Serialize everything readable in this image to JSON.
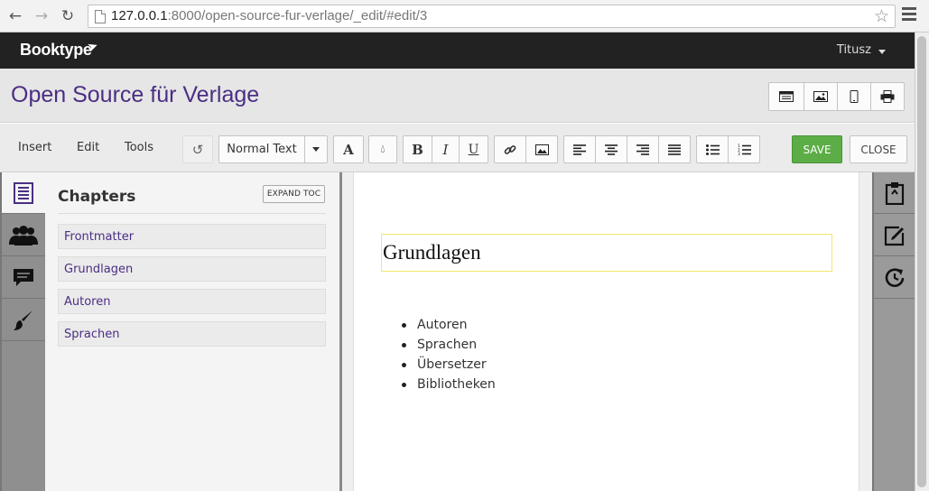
{
  "browser": {
    "url_host": "127.0.0.1",
    "url_rest": ":8000/open-source-fur-verlage/_edit/#edit/3"
  },
  "header": {
    "logo": "Booktype",
    "user": "Titusz"
  },
  "book": {
    "title": "Open Source für Verlage"
  },
  "view_buttons": [
    "toc-view-icon",
    "image-icon",
    "mobile-icon",
    "print-icon"
  ],
  "toolbar": {
    "menus": [
      "Insert",
      "Edit",
      "Tools"
    ],
    "style_select": "Normal Text",
    "save_label": "SAVE",
    "close_label": "CLOSE"
  },
  "toc": {
    "title": "Chapters",
    "expand_label": "EXPAND TOC",
    "chapters": [
      "Frontmatter",
      "Grundlagen",
      "Autoren",
      "Sprachen"
    ]
  },
  "editor": {
    "heading": "Grundlagen",
    "items": [
      "Autoren",
      "Sprachen",
      "Übersetzer",
      "Bibliotheken"
    ]
  },
  "colors": {
    "accent": "#4b2e83",
    "save": "#5cad46",
    "header": "#222222"
  }
}
